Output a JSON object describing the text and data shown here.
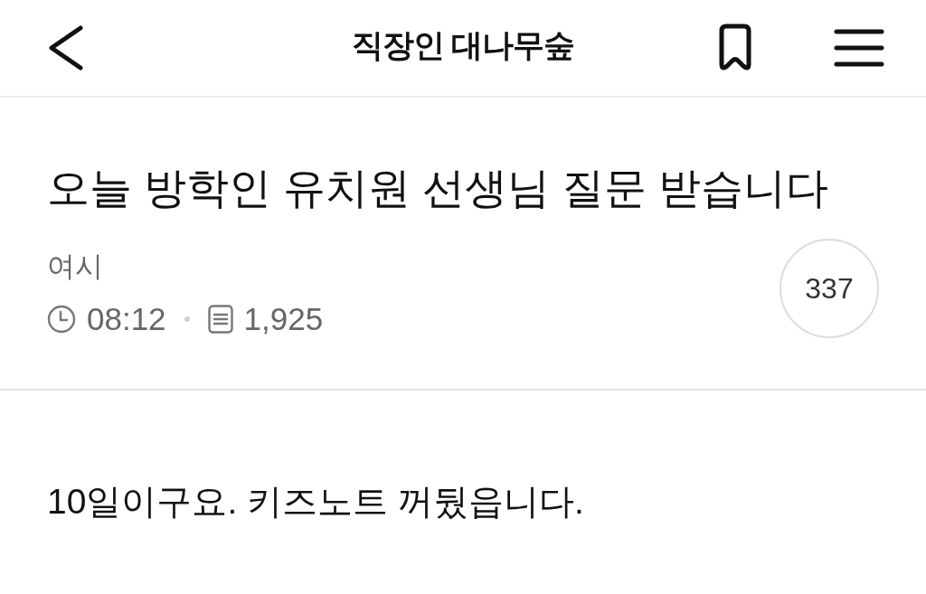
{
  "header": {
    "title": "직장인 대나무숲"
  },
  "post": {
    "title": "오늘 방학인 유치원 선생님 질문 받습니다",
    "author": "여시",
    "time": "08:12",
    "views": "1,925",
    "comment_count": "337"
  },
  "body": {
    "text": "10일이구요. 키즈노트 꺼뒀읍니다."
  }
}
